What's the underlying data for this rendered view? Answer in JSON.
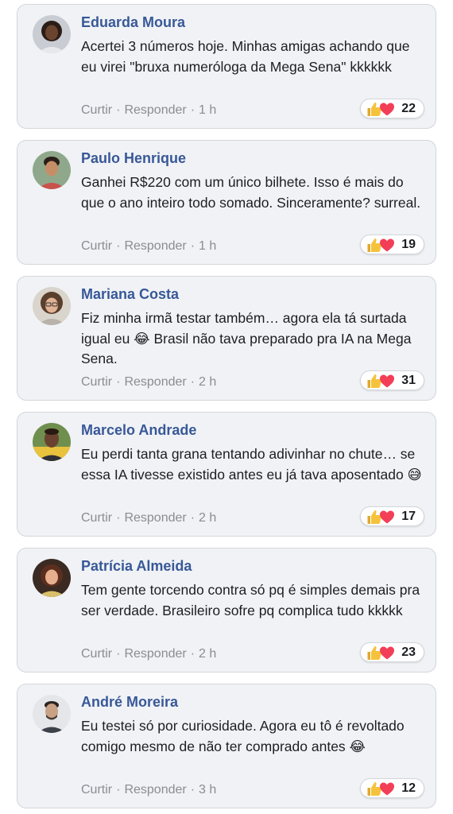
{
  "colors": {
    "card_bg": "#f0f2f5",
    "author_name": "#385898",
    "body_text": "#1c1e21",
    "meta_text": "#8a8d91",
    "like": "#f5c33b",
    "love": "#f33e58"
  },
  "icons": {
    "like": "thumbs-up-icon",
    "love": "heart-icon",
    "laugh": "tears-of-joy-emoji",
    "sweat": "grinning-sweat-emoji"
  },
  "comments": [
    {
      "author": "Eduarda Moura",
      "text": "Acertei 3 números hoje. Minhas amigas achando que eu virei \"bruxa numeróloga da Mega Sena\" kkkkkk",
      "like_label": "Curtir",
      "reply_label": "Responder",
      "time": "1 h",
      "reaction_count": "22"
    },
    {
      "author": "Paulo Henrique",
      "text": "Ganhei R$220 com um único bilhete. Isso é mais do que o ano inteiro todo somado. Sinceramente? surreal.",
      "like_label": "Curtir",
      "reply_label": "Responder",
      "time": "1 h",
      "reaction_count": "19"
    },
    {
      "author": "Mariana Costa",
      "text": "Fiz minha irmã testar também… agora ela tá surtada igual eu 😂 Brasil não tava preparado pra IA na Mega Sena.",
      "like_label": "Curtir",
      "reply_label": "Responder",
      "time": "2 h",
      "reaction_count": "31"
    },
    {
      "author": "Marcelo Andrade",
      "text": "Eu perdi tanta grana tentando adivinhar no chute… se essa IA tivesse existido antes eu já tava aposentado 😅",
      "like_label": "Curtir",
      "reply_label": "Responder",
      "time": "2 h",
      "reaction_count": "17"
    },
    {
      "author": "Patrícia Almeida",
      "text": "Tem gente torcendo contra só pq é simples demais pra ser verdade. Brasileiro sofre pq complica tudo kkkkk",
      "like_label": "Curtir",
      "reply_label": "Responder",
      "time": "2 h",
      "reaction_count": "23"
    },
    {
      "author": "André Moreira",
      "text": "Eu testei só por curiosidade. Agora eu tô é revoltado comigo mesmo de não ter comprado antes 😂",
      "like_label": "Curtir",
      "reply_label": "Responder",
      "time": "3 h",
      "reaction_count": "12"
    }
  ]
}
